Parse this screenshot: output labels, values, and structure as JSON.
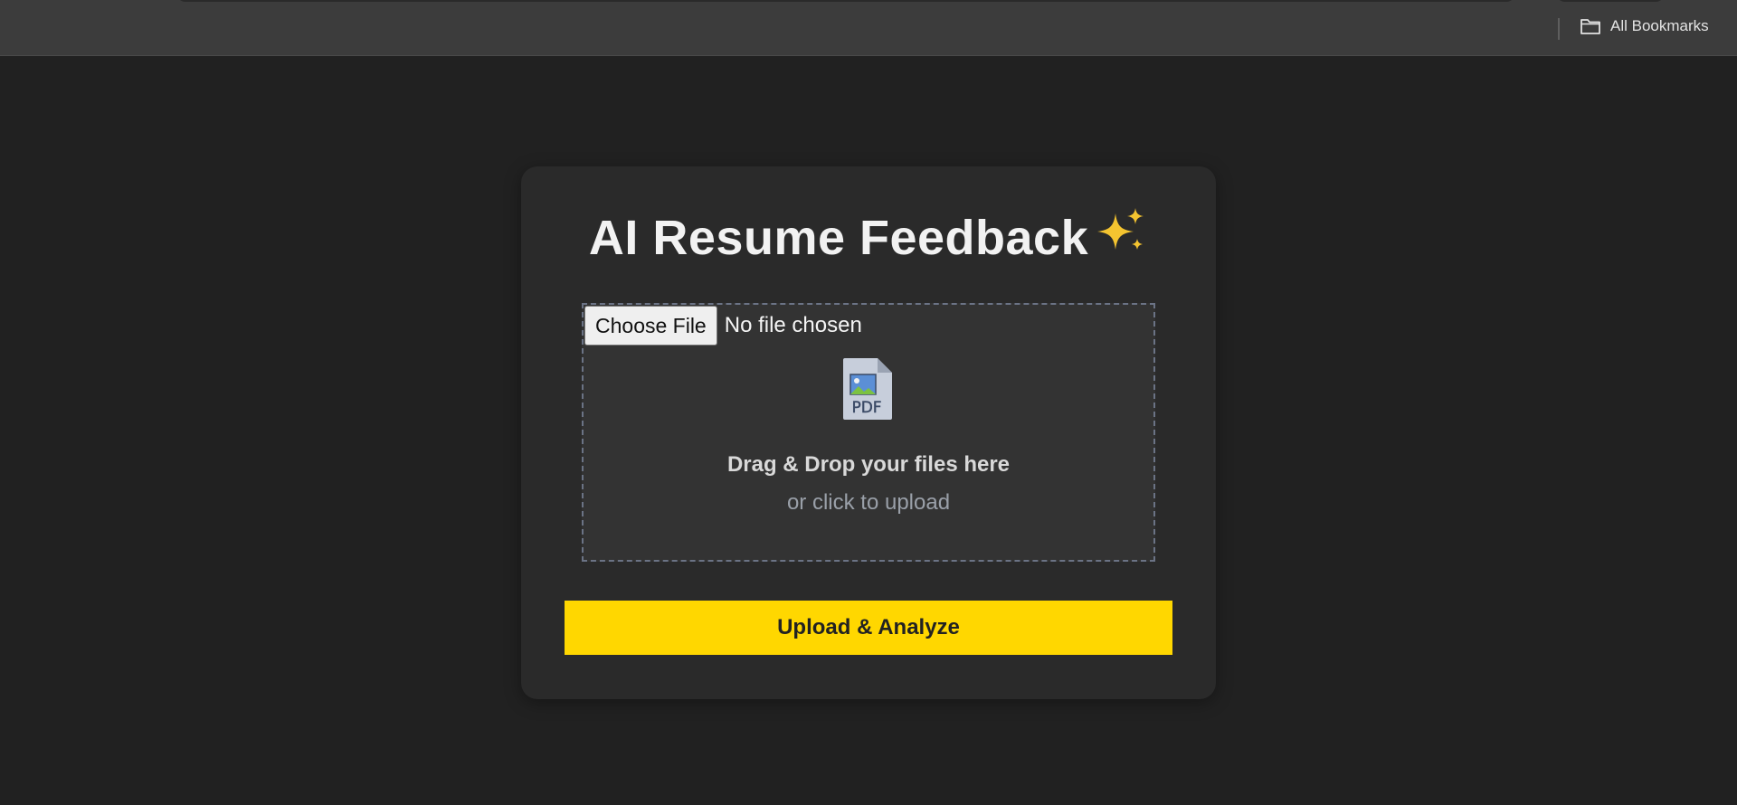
{
  "browser": {
    "bookmarks_label": "All Bookmarks"
  },
  "card": {
    "title": "AI Resume Feedback",
    "title_emoji": "✨"
  },
  "file_input": {
    "button_label": "Choose File",
    "status": "No file chosen"
  },
  "dropzone": {
    "icon": "pdf-file-icon",
    "main_text": "Drag & Drop your files here",
    "sub_text": "or click to upload"
  },
  "actions": {
    "upload_label": "Upload & Analyze"
  },
  "colors": {
    "background": "#212121",
    "card": "#2a2a2a",
    "accent": "#ffd700",
    "dropzone_border": "#6b7385"
  }
}
